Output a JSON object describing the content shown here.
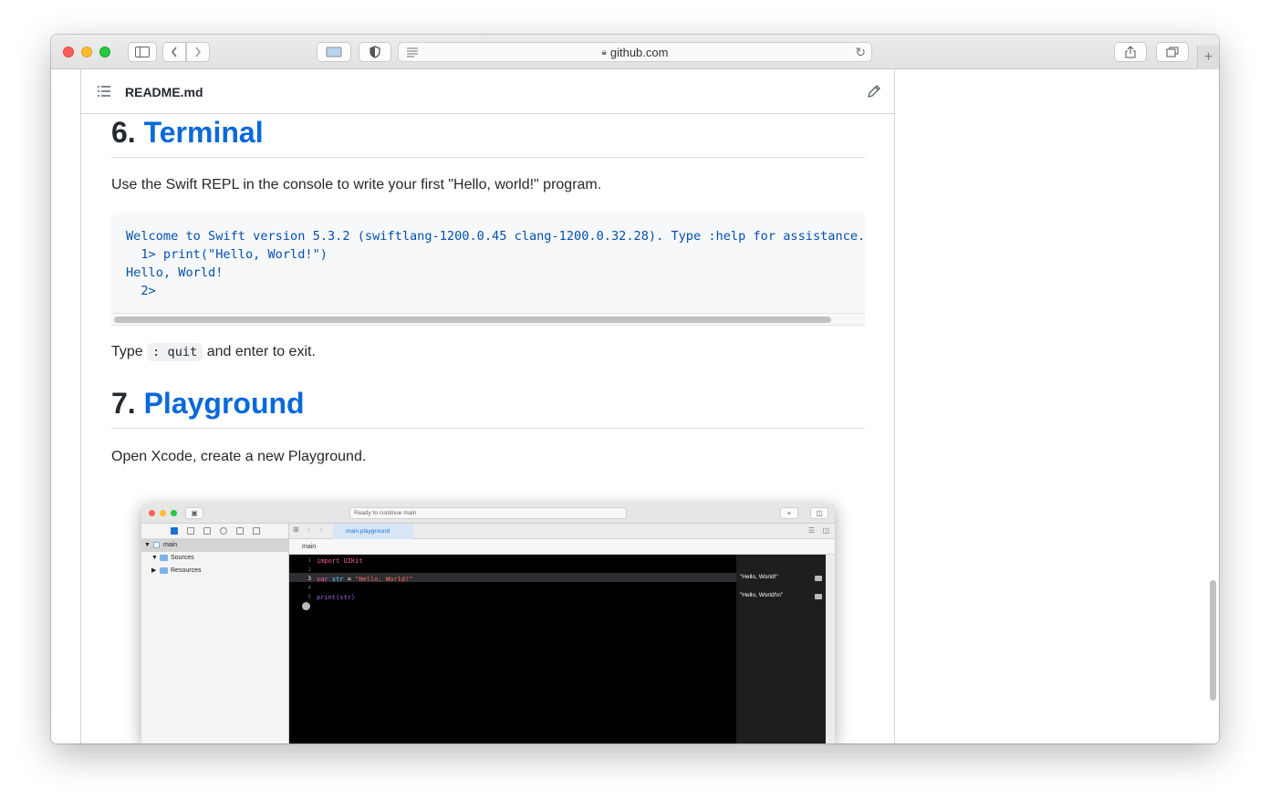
{
  "browser": {
    "url": "github.com",
    "new_tab": "+"
  },
  "readme": {
    "filename": "README.md"
  },
  "section6": {
    "number": "6.",
    "title": "Terminal",
    "intro": "Use the Swift REPL in the console to write your first \"Hello, world!\" program.",
    "code_lines": [
      "Welcome to Swift version 5.3.2 (swiftlang-1200.0.45 clang-1200.0.32.28). Type :help for assistance.",
      "  1> print(\"Hello, World!\")",
      "Hello, World!",
      "  2>"
    ],
    "exit_before": "Type",
    "exit_code": ": quit",
    "exit_after": "and enter to exit."
  },
  "section7": {
    "number": "7.",
    "title": "Playground",
    "intro": "Open Xcode, create a new Playground."
  },
  "xcode": {
    "status": "Ready to continue main",
    "tab": "main.playground",
    "jump_bar": "main",
    "nav": {
      "root": "main",
      "sources": "Sources",
      "resources": "Resources"
    },
    "code": {
      "line1": "import UIKit",
      "line3_kw": "var",
      "line3_id": "str",
      "line3_eq": " = ",
      "line3_str": "\"Hello, World!\"",
      "line5": "print(str)"
    },
    "line_numbers": [
      "1",
      "2",
      "3",
      "4",
      "5"
    ],
    "results": [
      "\"Hello, World!\"",
      "\"Hello, World!\\n\""
    ]
  }
}
